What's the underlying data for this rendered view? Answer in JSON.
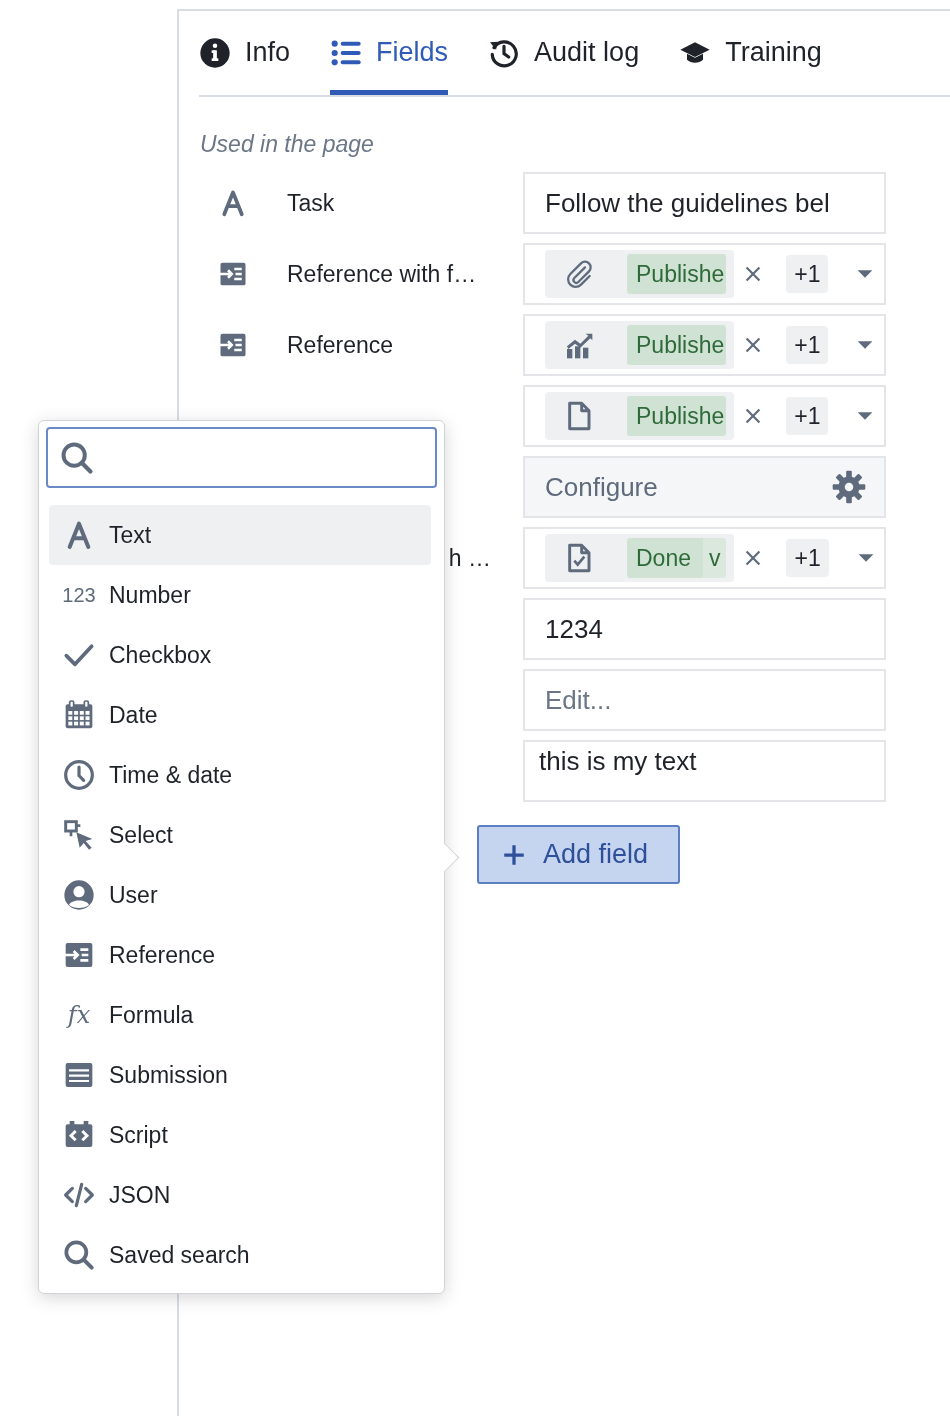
{
  "tabs": [
    {
      "label": "Info",
      "selected": false
    },
    {
      "label": "Fields",
      "selected": true
    },
    {
      "label": "Audit log",
      "selected": false
    },
    {
      "label": "Training",
      "selected": false
    }
  ],
  "section_title": "Used in the page",
  "fields": [
    {
      "label": "Task",
      "value": {
        "kind": "text",
        "text": "Follow the guidelines bel"
      }
    },
    {
      "label": "Reference with f…",
      "value": {
        "kind": "reference",
        "tag": "Publishe",
        "count": "+1"
      }
    },
    {
      "label": "Reference",
      "value": {
        "kind": "reference",
        "tag": "Publishe",
        "count": "+1"
      }
    },
    {
      "value": {
        "kind": "reference",
        "tag": "Publishe",
        "count": "+1"
      }
    },
    {
      "value": {
        "kind": "button",
        "text": "Configure"
      }
    },
    {
      "label_tail": "h …",
      "value": {
        "kind": "reference",
        "tag": "Done",
        "tag_extra": "v",
        "count": "+1"
      }
    },
    {
      "value": {
        "kind": "text",
        "text": "1234"
      }
    },
    {
      "value": {
        "kind": "input",
        "placeholder": "Edit..."
      }
    },
    {
      "value": {
        "kind": "textarea",
        "text": "this is my text"
      }
    }
  ],
  "add_button": "Add field",
  "type_menu": {
    "items": [
      {
        "label": "Text",
        "selected": true
      },
      {
        "label": "Number",
        "icon_text": "123",
        "selected": false
      },
      {
        "label": "Checkbox",
        "selected": false
      },
      {
        "label": "Date",
        "selected": false
      },
      {
        "label": "Time & date",
        "selected": false
      },
      {
        "label": "Select",
        "selected": false
      },
      {
        "label": "User",
        "selected": false
      },
      {
        "label": "Reference",
        "selected": false
      },
      {
        "label": "Formula",
        "icon_text": "fx",
        "selected": false
      },
      {
        "label": "Submission",
        "selected": false
      },
      {
        "label": "Script",
        "selected": false
      },
      {
        "label": "JSON",
        "selected": false
      },
      {
        "label": "Saved search",
        "selected": false
      }
    ]
  }
}
